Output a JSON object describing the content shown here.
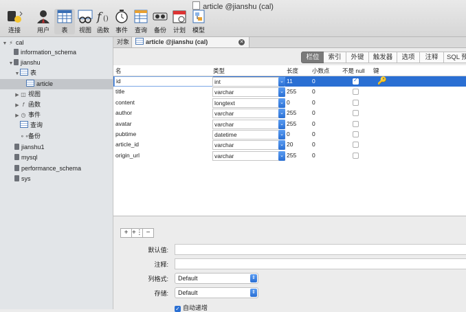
{
  "window": {
    "title": "article @jianshu (cal)"
  },
  "toolbar": {
    "items": [
      {
        "label": "连接",
        "icon": "connection-icon"
      },
      {
        "label": "用户",
        "icon": "user-icon"
      },
      {
        "label": "表",
        "icon": "table-icon"
      },
      {
        "label": "视图",
        "icon": "view-icon"
      },
      {
        "label": "函数",
        "icon": "function-icon"
      },
      {
        "label": "事件",
        "icon": "event-icon"
      },
      {
        "label": "查询",
        "icon": "query-icon"
      },
      {
        "label": "备份",
        "icon": "backup-icon"
      },
      {
        "label": "计划",
        "icon": "schedule-icon"
      },
      {
        "label": "模型",
        "icon": "model-icon"
      }
    ]
  },
  "sidebar": {
    "rows": [
      {
        "label": "cal"
      },
      {
        "label": "information_schema"
      },
      {
        "label": "jianshu"
      },
      {
        "label": "表"
      },
      {
        "label": "article"
      },
      {
        "label": "视图"
      },
      {
        "label": "函数"
      },
      {
        "label": "事件"
      },
      {
        "label": "查询"
      },
      {
        "label": "备份"
      },
      {
        "label": "jianshu1"
      },
      {
        "label": "mysql"
      },
      {
        "label": "performance_schema"
      },
      {
        "label": "sys"
      }
    ]
  },
  "tabs": {
    "objects": "对象",
    "active": "article @jianshu (cal)"
  },
  "segments": [
    "栏位",
    "索引",
    "外键",
    "触发器",
    "选项",
    "注释",
    "SQL 预"
  ],
  "grid": {
    "headers": {
      "name": "名",
      "type": "类型",
      "length": "长度",
      "decimals": "小数点",
      "not_null": "不是 null",
      "key": "键"
    },
    "rows": [
      {
        "name": "id",
        "type": "int",
        "length": "11",
        "decimals": "0",
        "not_null": true,
        "key": true
      },
      {
        "name": "title",
        "type": "varchar",
        "length": "255",
        "decimals": "0",
        "not_null": false,
        "key": false
      },
      {
        "name": "content",
        "type": "longtext",
        "length": "0",
        "decimals": "0",
        "not_null": false,
        "key": false
      },
      {
        "name": "author",
        "type": "varchar",
        "length": "255",
        "decimals": "0",
        "not_null": false,
        "key": false
      },
      {
        "name": "avatar",
        "type": "varchar",
        "length": "255",
        "decimals": "0",
        "not_null": false,
        "key": false
      },
      {
        "name": "pubtime",
        "type": "datetime",
        "length": "0",
        "decimals": "0",
        "not_null": false,
        "key": false
      },
      {
        "name": "article_id",
        "type": "varchar",
        "length": "20",
        "decimals": "0",
        "not_null": false,
        "key": false
      },
      {
        "name": "origin_url",
        "type": "varchar",
        "length": "255",
        "decimals": "0",
        "not_null": false,
        "key": false
      }
    ]
  },
  "bottom": {
    "buttons": [
      "+",
      "+⋮",
      "−"
    ],
    "default_label": "默认值:",
    "comment_label": "注释:",
    "column_format_label": "列格式:",
    "column_format_value": "Default",
    "storage_label": "存储:",
    "storage_value": "Default",
    "auto_increment_label": "自动递增"
  }
}
